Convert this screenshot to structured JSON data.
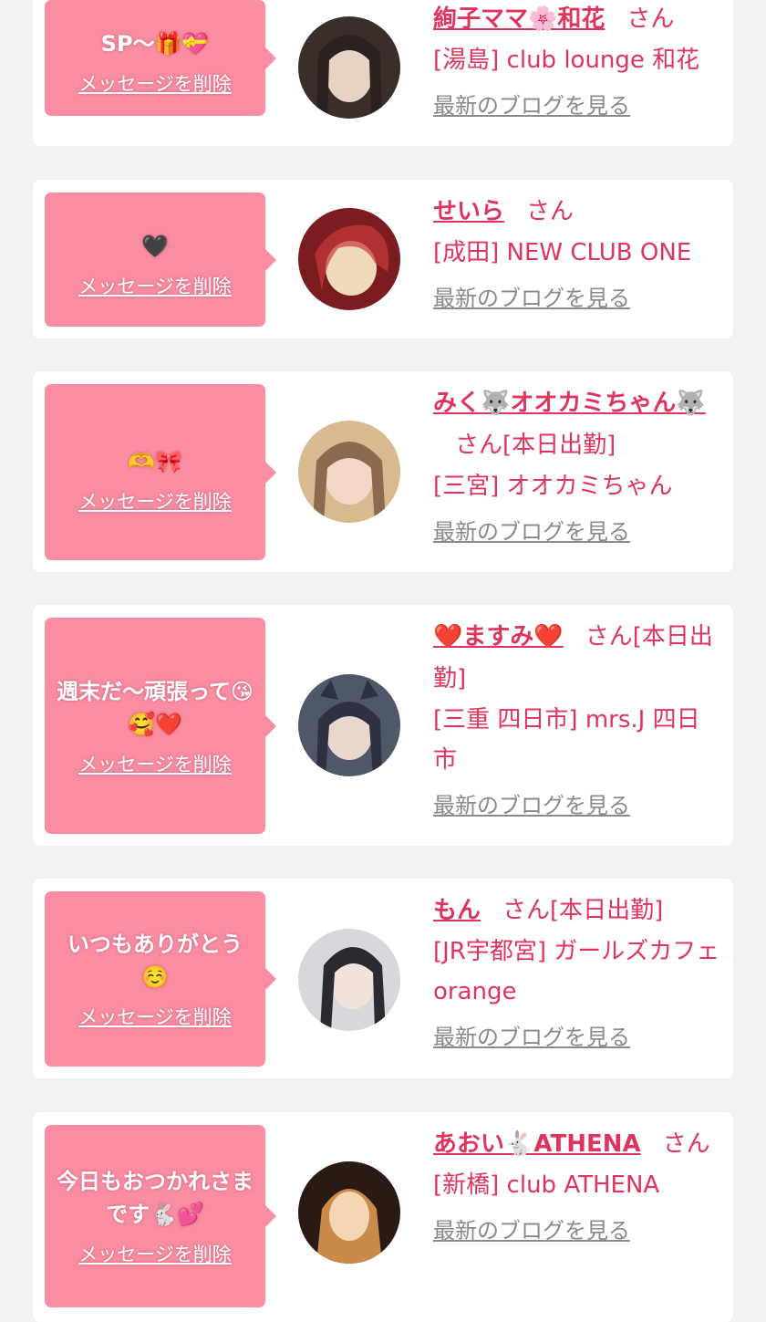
{
  "cards": [
    {
      "message": "SP〜🎁💝",
      "delete_label": "メッセージを削除",
      "name": "絢子ママ🌸和花",
      "honorific": "さん",
      "shop": "[湯島] club lounge 和花",
      "blog_label": "最新のブログを見る",
      "avatar_colors": [
        "#3a2e2a",
        "#e8d2c4",
        "#2b2220"
      ]
    },
    {
      "message": "🖤",
      "delete_label": "メッセージを削除",
      "name": "せいら",
      "honorific": "さん",
      "shop": "[成田] NEW CLUB ONE",
      "blog_label": "最新のブログを見る",
      "avatar_colors": [
        "#7a1c20",
        "#efd9b8",
        "#c93a3a"
      ]
    },
    {
      "message": "🫶🎀",
      "delete_label": "メッセージを削除",
      "name": "みく🐺オオカミちゃん🐺",
      "honorific": "さん[本日出勤]",
      "shop": "[三宮] オオカミちゃん",
      "blog_label": "最新のブログを見る",
      "avatar_colors": [
        "#d9b98f",
        "#f2d7c8",
        "#8c6a4f"
      ]
    },
    {
      "message": "週末だ〜頑張って😘🥰❤️",
      "delete_label": "メッセージを削除",
      "name": "❤️ますみ❤️",
      "honorific": "さん[本日出勤]",
      "shop": "[三重 四日市] mrs.J 四日市",
      "blog_label": "最新のブログを見る",
      "avatar_colors": [
        "#4f5868",
        "#e9d6cc",
        "#2d3140"
      ]
    },
    {
      "message": "いつもありがとう☺️",
      "delete_label": "メッセージを削除",
      "name": "もん",
      "honorific": "さん[本日出勤]",
      "shop": "[JR宇都宮] ガールズカフェ orange",
      "blog_label": "最新のブログを見る",
      "avatar_colors": [
        "#d8d8dc",
        "#f1e2dc",
        "#2a2a30"
      ]
    },
    {
      "message": "今日もおつかれさまです🐇💕",
      "delete_label": "メッセージを削除",
      "name": "あおい🐇ATHENA",
      "honorific": "さん",
      "shop": "[新橋] club ATHENA",
      "blog_label": "最新のブログを見る",
      "avatar_colors": [
        "#2a1a14",
        "#f5d6b2",
        "#c98a4a"
      ]
    }
  ]
}
